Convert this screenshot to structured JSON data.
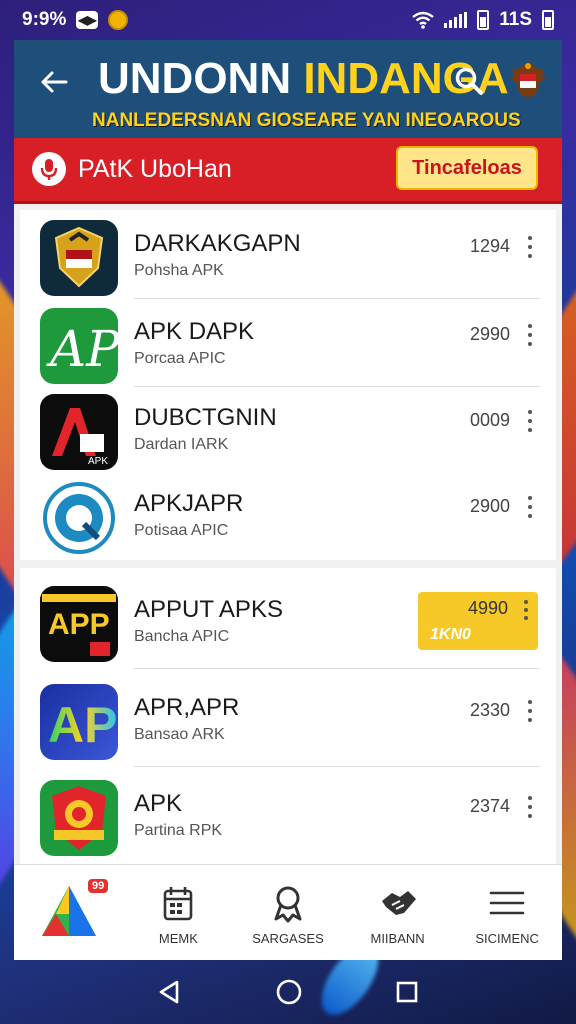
{
  "status_bar": {
    "time": "9:9%",
    "right_text": "11S",
    "icons": [
      "screen-record-icon",
      "coin-icon",
      "wifi-icon",
      "signal-icon",
      "sim-icon",
      "battery-icon"
    ]
  },
  "header": {
    "title_white": "UNDONN ",
    "title_yellow": "INDANGA",
    "subtitle": "NANLEDERSNAN GIOSEARE YAN INEOAROUS",
    "icons": [
      "back-arrow-icon",
      "search-icon",
      "emblem-icon"
    ]
  },
  "search_bar": {
    "label": "PAtK UboHan",
    "button_label": "Tincafeloas",
    "accent": "#d81f26",
    "button_bg": "#ffe58a"
  },
  "apps_group1": [
    {
      "name": "DARKAKGAPN",
      "subtitle": "Pohsha APK",
      "count": "1294",
      "icon": "crest-icon"
    },
    {
      "name": "APK DAPK",
      "subtitle": "Porcaa APIC",
      "count": "2990",
      "icon": "ap-logo-icon"
    },
    {
      "name": "DUBCTGNIN",
      "subtitle": "Dardan IARK",
      "count": "0009",
      "icon": "a-apk-icon"
    },
    {
      "name": "APKJAPR",
      "subtitle": "Potisaa APIC",
      "count": "2900",
      "icon": "q-badge-icon"
    }
  ],
  "apps_group2": [
    {
      "name": "APPUT APKS",
      "subtitle": "Bancha APIC",
      "count": "4990",
      "count_secondary": "1KN0",
      "highlighted": true,
      "icon": "app-yellow-icon",
      "icon_text": "APP"
    },
    {
      "name": "APR,APR",
      "subtitle": "Bansao ARK",
      "count": "2330",
      "icon": "ap-gradient-icon"
    },
    {
      "name": "APK",
      "subtitle": "Partina RPK",
      "count": "2374",
      "icon": "shield-badge-icon"
    }
  ],
  "bottom_nav": {
    "badge": "99",
    "items": [
      {
        "label": "",
        "icon": "home-triangle-icon"
      },
      {
        "label": "MEMK",
        "icon": "calendar-icon"
      },
      {
        "label": "SARGASES",
        "icon": "award-icon"
      },
      {
        "label": "MIIBANN",
        "icon": "handshake-icon"
      },
      {
        "label": "SICIMENC",
        "icon": "menu-icon"
      }
    ]
  },
  "system_nav": [
    "back-triangle-icon",
    "home-circle-icon",
    "recents-square-icon"
  ]
}
